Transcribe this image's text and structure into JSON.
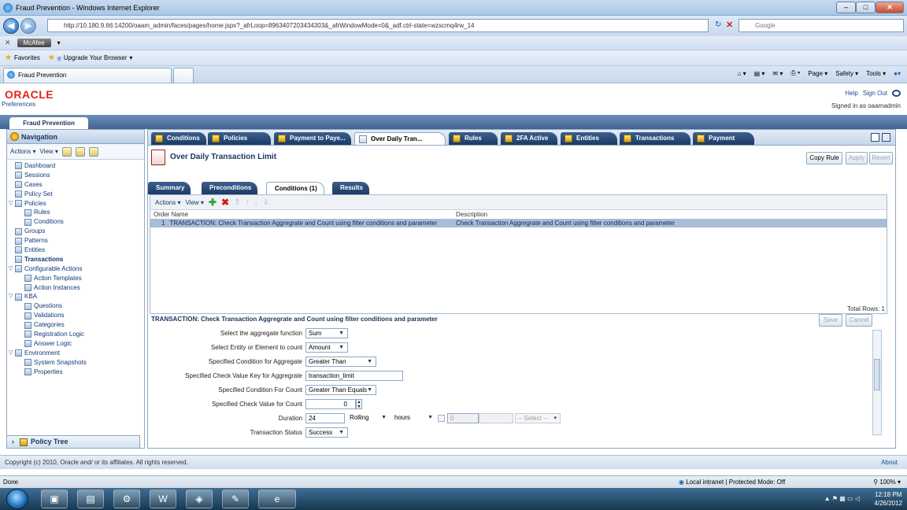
{
  "browser": {
    "window_title": "Fraud Prevention - Windows Internet Explorer",
    "url": "http://10.180.9.66:14200/oaam_admin/faces/pages/home.jspx?_afrLoop=8963407203434303&_afrWindowMode=0&_adf.ctrl-state=wzscmq4rw_14",
    "search_placeholder": "Google",
    "toolbar_plugin": "McAfee",
    "favorites_label": "Favorites",
    "upgrade_label": "Upgrade Your Browser",
    "tab_title": "Fraud Prevention",
    "command_items": [
      "Page",
      "Safety",
      "Tools"
    ]
  },
  "app": {
    "logo": "ORACLE",
    "preferences": "Preferences",
    "help": "Help",
    "sign_out": "Sign Out",
    "signed_in": "Signed in as oaamadmin",
    "app_tab": "Fraud Prevention"
  },
  "navigation": {
    "title": "Navigation",
    "actions": "Actions",
    "view": "View",
    "items": [
      {
        "label": "Dashboard",
        "level": 1
      },
      {
        "label": "Sessions",
        "level": 1
      },
      {
        "label": "Cases",
        "level": 1
      },
      {
        "label": "Policy Set",
        "level": 1
      },
      {
        "label": "Policies",
        "level": 0,
        "expanded": true
      },
      {
        "label": "Rules",
        "level": 2
      },
      {
        "label": "Conditions",
        "level": 2
      },
      {
        "label": "Groups",
        "level": 1
      },
      {
        "label": "Patterns",
        "level": 1
      },
      {
        "label": "Entities",
        "level": 1
      },
      {
        "label": "Transactions",
        "level": 1,
        "bold": true
      },
      {
        "label": "Configurable Actions",
        "level": 0,
        "expanded": true
      },
      {
        "label": "Action Templates",
        "level": 2
      },
      {
        "label": "Action Instances",
        "level": 2
      },
      {
        "label": "KBA",
        "level": 0,
        "expanded": true
      },
      {
        "label": "Questions",
        "level": 2
      },
      {
        "label": "Validations",
        "level": 2
      },
      {
        "label": "Categories",
        "level": 2
      },
      {
        "label": "Registration Logic",
        "level": 2
      },
      {
        "label": "Answer Logic",
        "level": 2
      },
      {
        "label": "Environment",
        "level": 0,
        "expanded": true
      },
      {
        "label": "System Snapshots",
        "level": 2
      },
      {
        "label": "Properties",
        "level": 2
      }
    ],
    "policy_tree": "Policy Tree"
  },
  "main": {
    "tabs": [
      "Conditions",
      "Policies",
      "Payment to Paye...",
      "Over Daily Tran...",
      "Rules",
      "2FA Active",
      "Entities",
      "Transactions",
      "Payment"
    ],
    "active_tab": 3,
    "page_title": "Over Daily Transaction Limit",
    "copy_rule": "Copy Rule",
    "apply": "Apply",
    "revert": "Revert",
    "subtabs": [
      "Summary",
      "Preconditions",
      "Conditions (1)",
      "Results"
    ],
    "active_subtab": 2,
    "conditions": {
      "actions": "Actions",
      "view": "View",
      "col_order": "Order",
      "col_name": "Name",
      "col_description": "Description",
      "rows": [
        {
          "order": "1",
          "name": "TRANSACTION: Check Transaction Aggregrate and Count using filter conditions and parameter",
          "description": "Check Transaction Aggregrate and Count using filter conditions and parameter"
        }
      ],
      "total_rows": "Total Rows: 1"
    },
    "detail": {
      "header": "TRANSACTION: Check Transaction Aggregrate and Count using filter conditions and parameter",
      "save": "Save",
      "cancel": "Cancel",
      "fields": {
        "aggregate_function_label": "Select the aggregate function",
        "aggregate_function_value": "Sum",
        "entity_label": "Select Entity or Element to count",
        "entity_value": "Amount",
        "cond_aggregate_label": "Specified Condition for Aggregate",
        "cond_aggregate_value": "Greater Than",
        "check_key_label": "Specified Check Value Key for Aggregrate",
        "check_key_value": "transaction_limit",
        "cond_count_label": "Specified Condition For Count",
        "cond_count_value": "Greater Than Equals",
        "check_count_label": "Specified Check Value for Count",
        "check_count_value": "0",
        "duration_label": "Duration",
        "duration_value": "24",
        "rolling_value": "Rolling",
        "hours_value": "hours",
        "extra_value": "0",
        "select_value": "-- Select --",
        "status_label": "Transaction Status",
        "status_value": "Success"
      }
    }
  },
  "footer": {
    "copyright": "Copyright (c) 2010, Oracle and/ or its affiliates. All rights reserved.",
    "about": "About"
  },
  "status": {
    "done": "Done",
    "zone": "Local intranet | Protected Mode: Off",
    "zoom": "100%"
  },
  "taskbar": {
    "time": "12:18 PM",
    "date": "4/26/2012"
  }
}
